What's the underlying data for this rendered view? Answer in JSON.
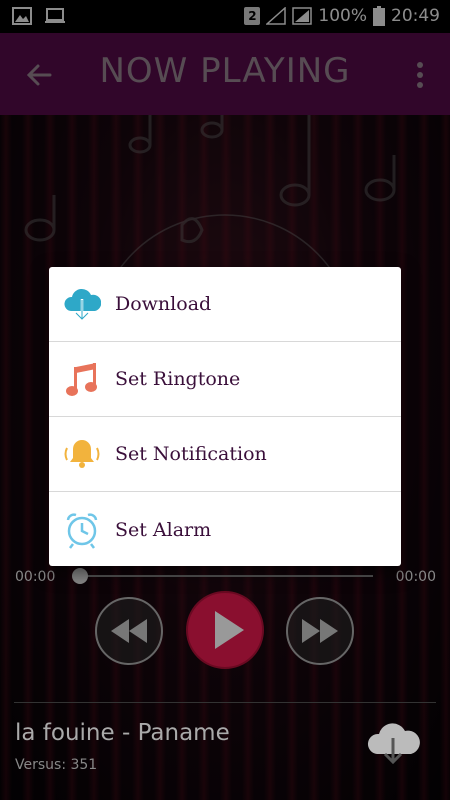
{
  "status_bar": {
    "sim_badge": "2",
    "battery": "100%",
    "time": "20:49"
  },
  "app_bar": {
    "title": "NOW PLAYING"
  },
  "player": {
    "time_elapsed": "00:00",
    "time_total": "00:00",
    "track_title": "la fouine -  Paname",
    "track_subtitle": "Versus: 351"
  },
  "dialog": {
    "items": [
      {
        "label": "Download",
        "icon": "cloud-download-icon",
        "color": "#2ea8c8"
      },
      {
        "label": "Set Ringtone",
        "icon": "music-note-icon",
        "color": "#e8735a"
      },
      {
        "label": "Set Notification",
        "icon": "bell-icon",
        "color": "#f2b33d"
      },
      {
        "label": "Set Alarm",
        "icon": "alarm-clock-icon",
        "color": "#6fc6e8"
      }
    ]
  },
  "colors": {
    "app_bar": "#5a0b4d",
    "play_button": "#8a0f2f",
    "dialog_text": "#3a0f3a"
  }
}
